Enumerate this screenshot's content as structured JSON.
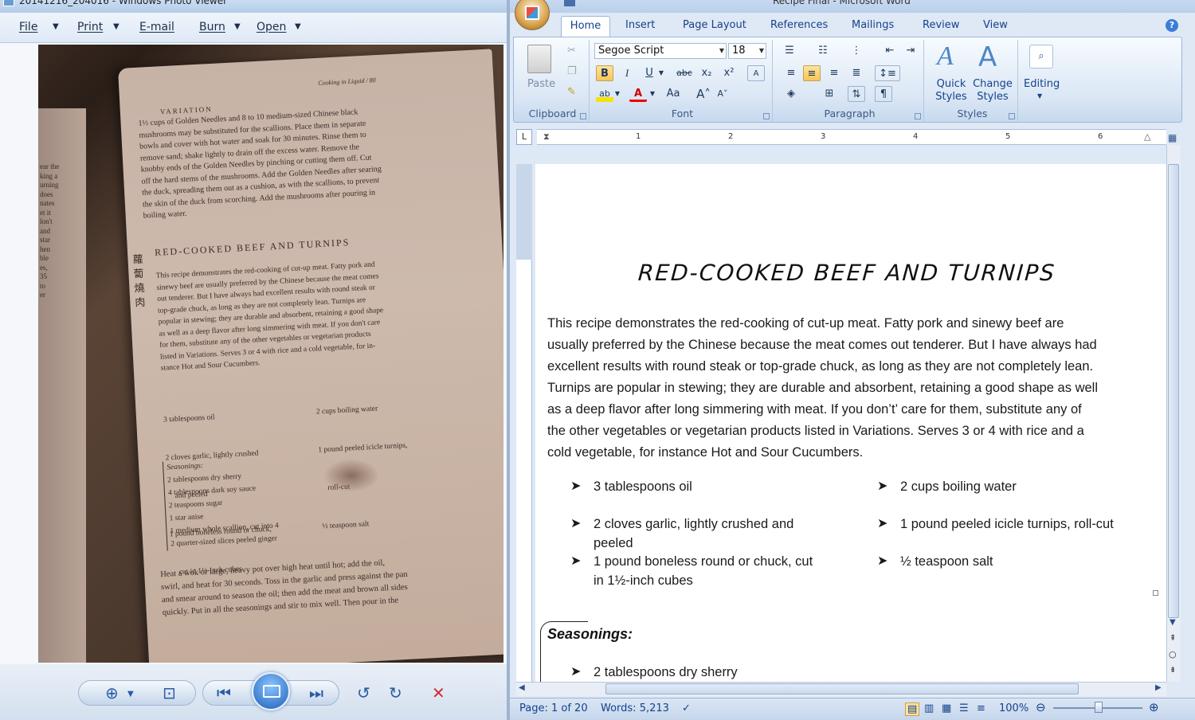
{
  "photo_viewer": {
    "title": "20141216_204016 - Windows Photo Viewer",
    "menu": [
      "File",
      "Print",
      "E-mail",
      "Burn",
      "Open"
    ],
    "book_page": {
      "running_head": "Cooking in Liquid / 80",
      "variation_title": "VARIATION",
      "variation_text": [
        "1½ cups of Golden Needles and 8 to 10 medium-sized Chinese black",
        "mushrooms may be substituted for the scallions. Place them in separate",
        "bowls and cover with hot water and soak for 30 minutes. Rinse them to",
        "remove sand; shake lightly to drain off the excess water. Remove the",
        "knobby ends of the Golden Needles by pinching or cutting them off. Cut",
        "off the hard stems of the mushrooms. Add the Golden Needles after searing",
        "the duck, spreading them out as a cushion, as with the scallions, to prevent",
        "the skin of the duck from scorching. Add the mushrooms after pouring in",
        "boiling water."
      ],
      "recipe_title": "RED-COOKED BEEF AND TURNIPS",
      "chinese_chars": "蘿蔔燒肉",
      "recipe_text": [
        "This recipe demonstrates the red-cooking of cut-up meat. Fatty pork and",
        "sinewy beef are usually preferred by the Chinese because the meat comes",
        "out tenderer. But I have always had excellent results with round steak or",
        "top-grade chuck, as long as they are not completely lean. Turnips are",
        "popular in stewing; they are durable and absorbent, retaining a good shape",
        "as well as a deep flavor after long simmering with meat. If you don't care",
        "for them, substitute any of the other vegetables or vegetarian products",
        "listed in Variations. Serves 3 or 4 with rice and a cold vegetable, for in-",
        "stance Hot and Sour Cucumbers."
      ],
      "ingredients_left": [
        "3 tablespoons oil",
        "2 cloves garlic, lightly crushed",
        "    and peeled",
        "1 pound boneless round or chuck,",
        "    cut in 1½-inch cubes"
      ],
      "ingredients_right": [
        "2 cups boiling water",
        "1 pound peeled icicle turnips,",
        "    roll-cut",
        "½ teaspoon salt"
      ],
      "seasonings": [
        "Seasonings:",
        "2 tablespoons dry sherry",
        "4 tablespoons dark soy sauce",
        "2 teaspoons sugar",
        "1 star anise",
        "1 medium whole scallion, cut into 4",
        "2 quarter-sized slices peeled ginger"
      ],
      "method": [
        "Heat a wok or large, heavy pot over high heat until hot; add the oil,",
        "swirl, and heat for 30 seconds. Toss in the garlic and press against the pan",
        "and smear around to season the oil; then add the meat and brown all sides",
        "quickly. Put in all the seasonings and stir to mix well. Then pour in the"
      ]
    },
    "left_page_fragments": [
      "ear the",
      "king a",
      "urning",
      " does",
      "nates",
      "",
      "et it",
      "lon't",
      "and",
      "star",
      "hen",
      "ble",
      "es,",
      "35",
      "to",
      "er"
    ]
  },
  "word": {
    "title": "Recipe Final - Microsoft Word",
    "tabs": [
      "Home",
      "Insert",
      "Page Layout",
      "References",
      "Mailings",
      "Review",
      "View"
    ],
    "active_tab": "Home",
    "ribbon": {
      "clipboard": {
        "label": "Clipboard",
        "paste": "Paste"
      },
      "font": {
        "label": "Font",
        "font_name": "Segoe Script",
        "font_size": "18",
        "change_case": "Aa"
      },
      "paragraph": {
        "label": "Paragraph"
      },
      "styles": {
        "label": "Styles",
        "quick_styles": [
          "Quick",
          "Styles"
        ],
        "change_styles": [
          "Change",
          "Styles"
        ]
      },
      "editing": {
        "label": "Editing"
      }
    },
    "ruler_numbers": [
      "1",
      "2",
      "3",
      "4",
      "5",
      "6"
    ],
    "document": {
      "title": "RED-COOKED BEEF AND TURNIPS",
      "body_lines": [
        "This recipe demonstrates the red-cooking of cut-up meat. Fatty pork and sinewy beef are",
        "usually preferred by the Chinese because the meat comes out tenderer. But I have always had",
        "excellent results with round steak or top-grade chuck, as long as they are not completely lean.",
        "Turnips are popular in stewing; they are durable and absorbent, retaining a good shape as well",
        "as a deep flavor after long simmering with meat. If you don’t’ care for them, substitute any of",
        "the other vegetables or vegetarian products listed in Variations. Serves 3 or 4 with rice and a",
        "cold vegetable, for instance Hot and Sour Cucumbers."
      ],
      "ingredients_left": [
        [
          "3 tablespoons oil"
        ],
        [
          "2 cloves garlic, lightly crushed and",
          "peeled"
        ],
        [
          "1 pound boneless round or chuck, cut",
          "in 1½-inch cubes"
        ]
      ],
      "ingredients_right": [
        [
          "2 cups boiling water"
        ],
        [
          "1 pound peeled icicle turnips, roll-cut"
        ],
        [
          "½ teaspoon salt"
        ]
      ],
      "seasonings_heading": "Seasonings:",
      "seasonings": [
        "2 tablespoons dry sherry"
      ]
    },
    "status": {
      "page": "Page: 1 of 20",
      "words": "Words: 5,213",
      "zoom": "100%"
    }
  }
}
